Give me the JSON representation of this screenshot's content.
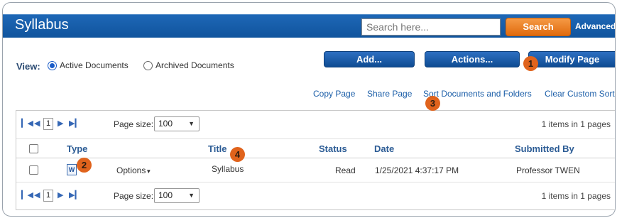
{
  "header": {
    "title": "Syllabus",
    "search_placeholder": "Search here...",
    "search_button": "Search",
    "advanced_link": "Advanced"
  },
  "view": {
    "label": "View:",
    "options": [
      {
        "label": "Active Documents",
        "selected": true
      },
      {
        "label": "Archived Documents",
        "selected": false
      }
    ]
  },
  "toolbar": {
    "add_label": "Add...",
    "actions_label": "Actions...",
    "modify_label": "Modify Page"
  },
  "links": {
    "copy_page": "Copy Page",
    "share_page": "Share Page",
    "sort_documents": "Sort Documents and Folders",
    "clear_sort": "Clear Custom Sort"
  },
  "badges": [
    "1",
    "2",
    "3",
    "4"
  ],
  "pager": {
    "current_page": "1",
    "page_size_label": "Page size:",
    "page_size_value": "100",
    "items_info": "1 items in 1 pages"
  },
  "columns": [
    "Type",
    "Title",
    "Status",
    "Date",
    "Submitted By"
  ],
  "rows": [
    {
      "type_icon": "word-document-icon",
      "options_label": "Options",
      "title": "Syllabus",
      "status": "Read",
      "date": "1/25/2021 4:37:17 PM",
      "submitted_by": "Professor TWEN"
    }
  ],
  "colors": {
    "header_blue": "#10549d",
    "search_orange": "#e06a0d",
    "badge_orange": "#e0631c",
    "link_blue": "#1b5ea8"
  }
}
